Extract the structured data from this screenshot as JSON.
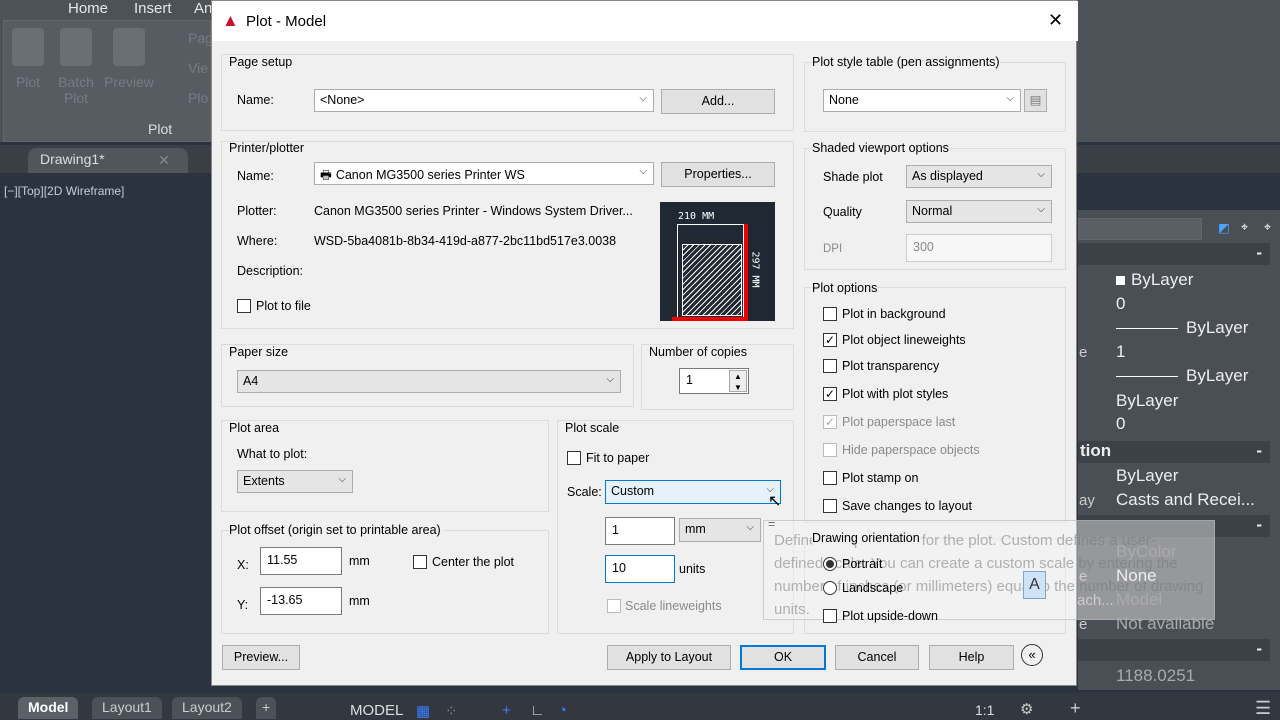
{
  "ribbon": {
    "tabs": [
      "Home",
      "Insert",
      "An"
    ],
    "buttons": [
      "Plot",
      "Batch Plot",
      "Preview"
    ],
    "small_buttons": [
      "Pag",
      "Vie",
      "Plo"
    ],
    "panel_title": "Plot"
  },
  "document_tab": "Drawing1*",
  "viewport_label": "[−][Top][2D Wireframe]",
  "properties": {
    "values": [
      "ByLayer",
      "0",
      "ByLayer",
      "1",
      "ByLayer",
      "ByLayer",
      "0"
    ],
    "section2": "tion",
    "section2_values": [
      "ByLayer",
      "Casts and Recei..."
    ],
    "section3_values": [
      "ByColor",
      "None",
      "Model",
      "Not available"
    ],
    "section4_value": "1188.0251",
    "left_fragments": [
      "e",
      "ay",
      "e",
      "ach...",
      "e"
    ]
  },
  "layout_tabs": [
    "Model",
    "Layout1",
    "Layout2"
  ],
  "status": {
    "model": "MODEL",
    "scale": "1:1"
  },
  "dialog": {
    "title": "Plot - Model",
    "page_setup": {
      "label": "Page setup",
      "name_label": "Name:",
      "name_value": "<None>",
      "add": "Add..."
    },
    "printer": {
      "label": "Printer/plotter",
      "name_label": "Name:",
      "name_value": "Canon MG3500 series Printer WS",
      "properties": "Properties...",
      "plotter_label": "Plotter:",
      "plotter_value": "Canon MG3500 series Printer - Windows System Driver...",
      "where_label": "Where:",
      "where_value": "WSD-5ba4081b-8b34-419d-a877-2bc11bd517e3.0038",
      "description_label": "Description:",
      "plot_to_file": "Plot to file",
      "plot_to_file_checked": false,
      "preview_width": "210 MM",
      "preview_height": "297 MM"
    },
    "paper_size": {
      "label": "Paper size",
      "value": "A4"
    },
    "copies": {
      "label": "Number of copies",
      "value": "1"
    },
    "plot_area": {
      "label": "Plot area",
      "what_label": "What to plot:",
      "what_value": "Extents"
    },
    "plot_offset": {
      "label": "Plot offset (origin set to printable area)",
      "x_label": "X:",
      "x_value": "11.55",
      "y_label": "Y:",
      "y_value": "-13.65",
      "unit": "mm",
      "center": "Center the plot",
      "center_checked": false
    },
    "plot_scale": {
      "label": "Plot scale",
      "fit": "Fit to paper",
      "fit_checked": false,
      "scale_label": "Scale:",
      "scale_value": "Custom",
      "value1": "1",
      "unit1": "mm",
      "equals": "=",
      "value2": "10",
      "unit2": "units",
      "lineweights": "Scale lineweights",
      "lineweights_checked": false
    },
    "style_table": {
      "label": "Plot style table (pen assignments)",
      "value": "None"
    },
    "shaded": {
      "label": "Shaded viewport options",
      "shade_label": "Shade plot",
      "shade_value": "As displayed",
      "quality_label": "Quality",
      "quality_value": "Normal",
      "dpi_label": "DPI",
      "dpi_value": "300"
    },
    "options": {
      "label": "Plot options",
      "items": [
        {
          "label": "Plot in background",
          "checked": false,
          "enabled": true
        },
        {
          "label": "Plot object lineweights",
          "checked": true,
          "enabled": true
        },
        {
          "label": "Plot transparency",
          "checked": false,
          "enabled": true
        },
        {
          "label": "Plot with plot styles",
          "checked": true,
          "enabled": true
        },
        {
          "label": "Plot paperspace last",
          "checked": true,
          "enabled": false
        },
        {
          "label": "Hide paperspace objects",
          "checked": false,
          "enabled": false
        },
        {
          "label": "Plot stamp on",
          "checked": false,
          "enabled": true
        },
        {
          "label": "Save changes to layout",
          "checked": false,
          "enabled": true
        }
      ]
    },
    "orientation": {
      "label": "Drawing orientation",
      "portrait": "Portrait",
      "landscape": "Landscape",
      "selected": "Portrait",
      "upside_down": "Plot upside-down",
      "upside_down_checked": false,
      "icon_letter": "A"
    },
    "buttons": {
      "preview": "Preview...",
      "apply": "Apply to Layout",
      "ok": "OK",
      "cancel": "Cancel",
      "help": "Help"
    },
    "tooltip": "Defines the plot scale for the plot. Custom defines a user-defined scale. You can create a custom scale by entering the number of inches (or millimeters) equal to the number of drawing units."
  },
  "colors": {
    "accent": "#0078d7",
    "autocad_red": "#c8102e",
    "preview_bg": "#1f2833"
  }
}
